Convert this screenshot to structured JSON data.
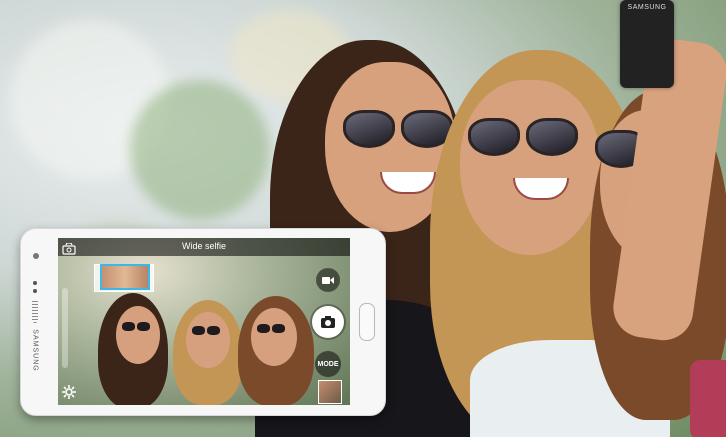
{
  "camera_app": {
    "mode_title": "Wide selfie",
    "mode_button_label": "MODE",
    "icons": {
      "switch_camera": "switch-camera-icon",
      "settings": "gear-icon",
      "video": "video-camera-icon",
      "shutter": "camera-icon",
      "gallery": "gallery-thumbnail"
    }
  },
  "device": {
    "brand": "SAMSUNG"
  },
  "background_phone": {
    "brand": "SAMSUNG"
  },
  "colors": {
    "panorama_frame": "#3db7e6",
    "device_body": "#f7f7f7"
  }
}
